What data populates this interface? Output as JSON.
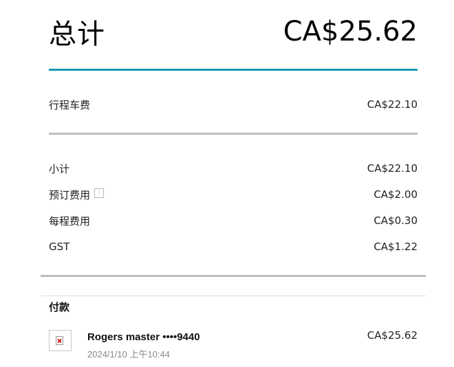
{
  "summary": {
    "total_label": "总计",
    "total_amount": "CA$25.62"
  },
  "fare": {
    "trip_fare_label": "行程车费",
    "trip_fare_amount": "CA$22.10"
  },
  "breakdown": {
    "items": [
      {
        "label": "小计",
        "amount": "CA$22.10"
      },
      {
        "label": "预订费用",
        "amount": "CA$2.00",
        "info_icon": "info-icon"
      },
      {
        "label": "每程费用",
        "amount": "CA$0.30"
      },
      {
        "label": "GST",
        "amount": "CA$1.22"
      }
    ]
  },
  "payment": {
    "heading": "付款",
    "card_icon": "broken-image-icon",
    "card_name": "Rogers master ••••9440",
    "timestamp": "2024/1/10 上午10:44",
    "amount": "CA$25.62"
  },
  "colors": {
    "accent": "#1a9bb5",
    "divider": "#bdbdbd",
    "muted_text": "#8a8a8a"
  }
}
